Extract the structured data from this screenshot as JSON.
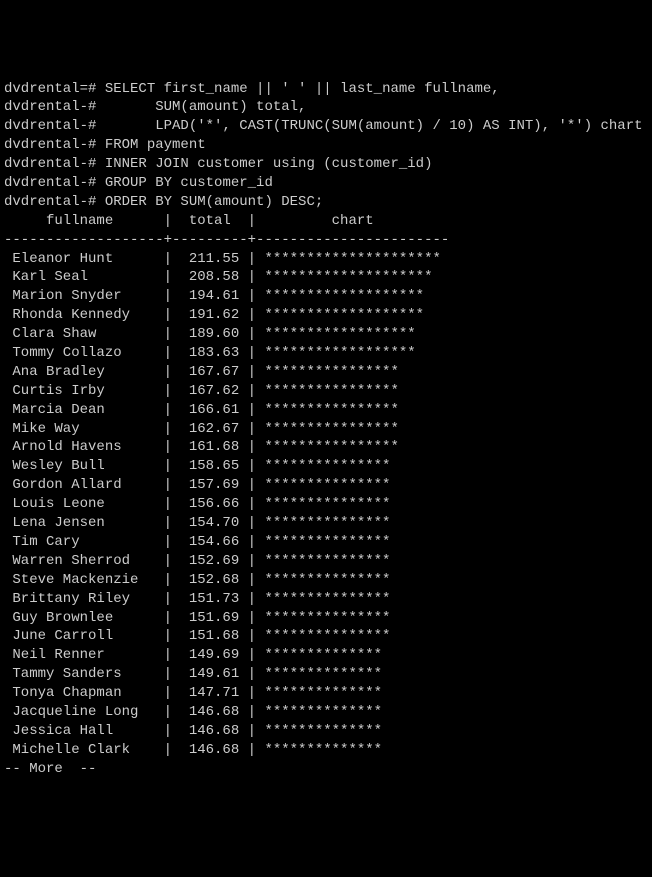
{
  "prompt": {
    "p1": "dvdrental=#",
    "p2": "dvdrental-#"
  },
  "sql": {
    "l1": " SELECT first_name || ' ' || last_name fullname,",
    "l2": "       SUM(amount) total,",
    "l3": "       LPAD('*', CAST(TRUNC(SUM(amount) / 10) AS INT), '*') chart",
    "l4": " FROM payment",
    "l5": " INNER JOIN customer using (customer_id)",
    "l6": " GROUP BY customer_id",
    "l7": " ORDER BY SUM(amount) DESC;"
  },
  "header": "     fullname      |  total  |         chart",
  "divider": "-------------------+---------+-----------------------",
  "rows": [
    {
      "name": "Eleanor Hunt",
      "total": "211.55",
      "stars": "*********************"
    },
    {
      "name": "Karl Seal",
      "total": "208.58",
      "stars": "********************"
    },
    {
      "name": "Marion Snyder",
      "total": "194.61",
      "stars": "*******************"
    },
    {
      "name": "Rhonda Kennedy",
      "total": "191.62",
      "stars": "*******************"
    },
    {
      "name": "Clara Shaw",
      "total": "189.60",
      "stars": "******************"
    },
    {
      "name": "Tommy Collazo",
      "total": "183.63",
      "stars": "******************"
    },
    {
      "name": "Ana Bradley",
      "total": "167.67",
      "stars": "****************"
    },
    {
      "name": "Curtis Irby",
      "total": "167.62",
      "stars": "****************"
    },
    {
      "name": "Marcia Dean",
      "total": "166.61",
      "stars": "****************"
    },
    {
      "name": "Mike Way",
      "total": "162.67",
      "stars": "****************"
    },
    {
      "name": "Arnold Havens",
      "total": "161.68",
      "stars": "****************"
    },
    {
      "name": "Wesley Bull",
      "total": "158.65",
      "stars": "***************"
    },
    {
      "name": "Gordon Allard",
      "total": "157.69",
      "stars": "***************"
    },
    {
      "name": "Louis Leone",
      "total": "156.66",
      "stars": "***************"
    },
    {
      "name": "Lena Jensen",
      "total": "154.70",
      "stars": "***************"
    },
    {
      "name": "Tim Cary",
      "total": "154.66",
      "stars": "***************"
    },
    {
      "name": "Warren Sherrod",
      "total": "152.69",
      "stars": "***************"
    },
    {
      "name": "Steve Mackenzie",
      "total": "152.68",
      "stars": "***************"
    },
    {
      "name": "Brittany Riley",
      "total": "151.73",
      "stars": "***************"
    },
    {
      "name": "Guy Brownlee",
      "total": "151.69",
      "stars": "***************"
    },
    {
      "name": "June Carroll",
      "total": "151.68",
      "stars": "***************"
    },
    {
      "name": "Neil Renner",
      "total": "149.69",
      "stars": "**************"
    },
    {
      "name": "Tammy Sanders",
      "total": "149.61",
      "stars": "**************"
    },
    {
      "name": "Tonya Chapman",
      "total": "147.71",
      "stars": "**************"
    },
    {
      "name": "Jacqueline Long",
      "total": "146.68",
      "stars": "**************"
    },
    {
      "name": "Jessica Hall",
      "total": "146.68",
      "stars": "**************"
    },
    {
      "name": "Michelle Clark",
      "total": "146.68",
      "stars": "**************"
    }
  ],
  "more": "-- More  --",
  "chart_data": {
    "type": "bar",
    "title": "",
    "xlabel": "total",
    "ylabel": "fullname",
    "categories": [
      "Eleanor Hunt",
      "Karl Seal",
      "Marion Snyder",
      "Rhonda Kennedy",
      "Clara Shaw",
      "Tommy Collazo",
      "Ana Bradley",
      "Curtis Irby",
      "Marcia Dean",
      "Mike Way",
      "Arnold Havens",
      "Wesley Bull",
      "Gordon Allard",
      "Louis Leone",
      "Lena Jensen",
      "Tim Cary",
      "Warren Sherrod",
      "Steve Mackenzie",
      "Brittany Riley",
      "Guy Brownlee",
      "June Carroll",
      "Neil Renner",
      "Tammy Sanders",
      "Tonya Chapman",
      "Jacqueline Long",
      "Jessica Hall",
      "Michelle Clark"
    ],
    "values": [
      211.55,
      208.58,
      194.61,
      191.62,
      189.6,
      183.63,
      167.67,
      167.62,
      166.61,
      162.67,
      161.68,
      158.65,
      157.69,
      156.66,
      154.7,
      154.66,
      152.69,
      152.68,
      151.73,
      151.69,
      151.68,
      149.69,
      149.61,
      147.71,
      146.68,
      146.68,
      146.68
    ]
  }
}
